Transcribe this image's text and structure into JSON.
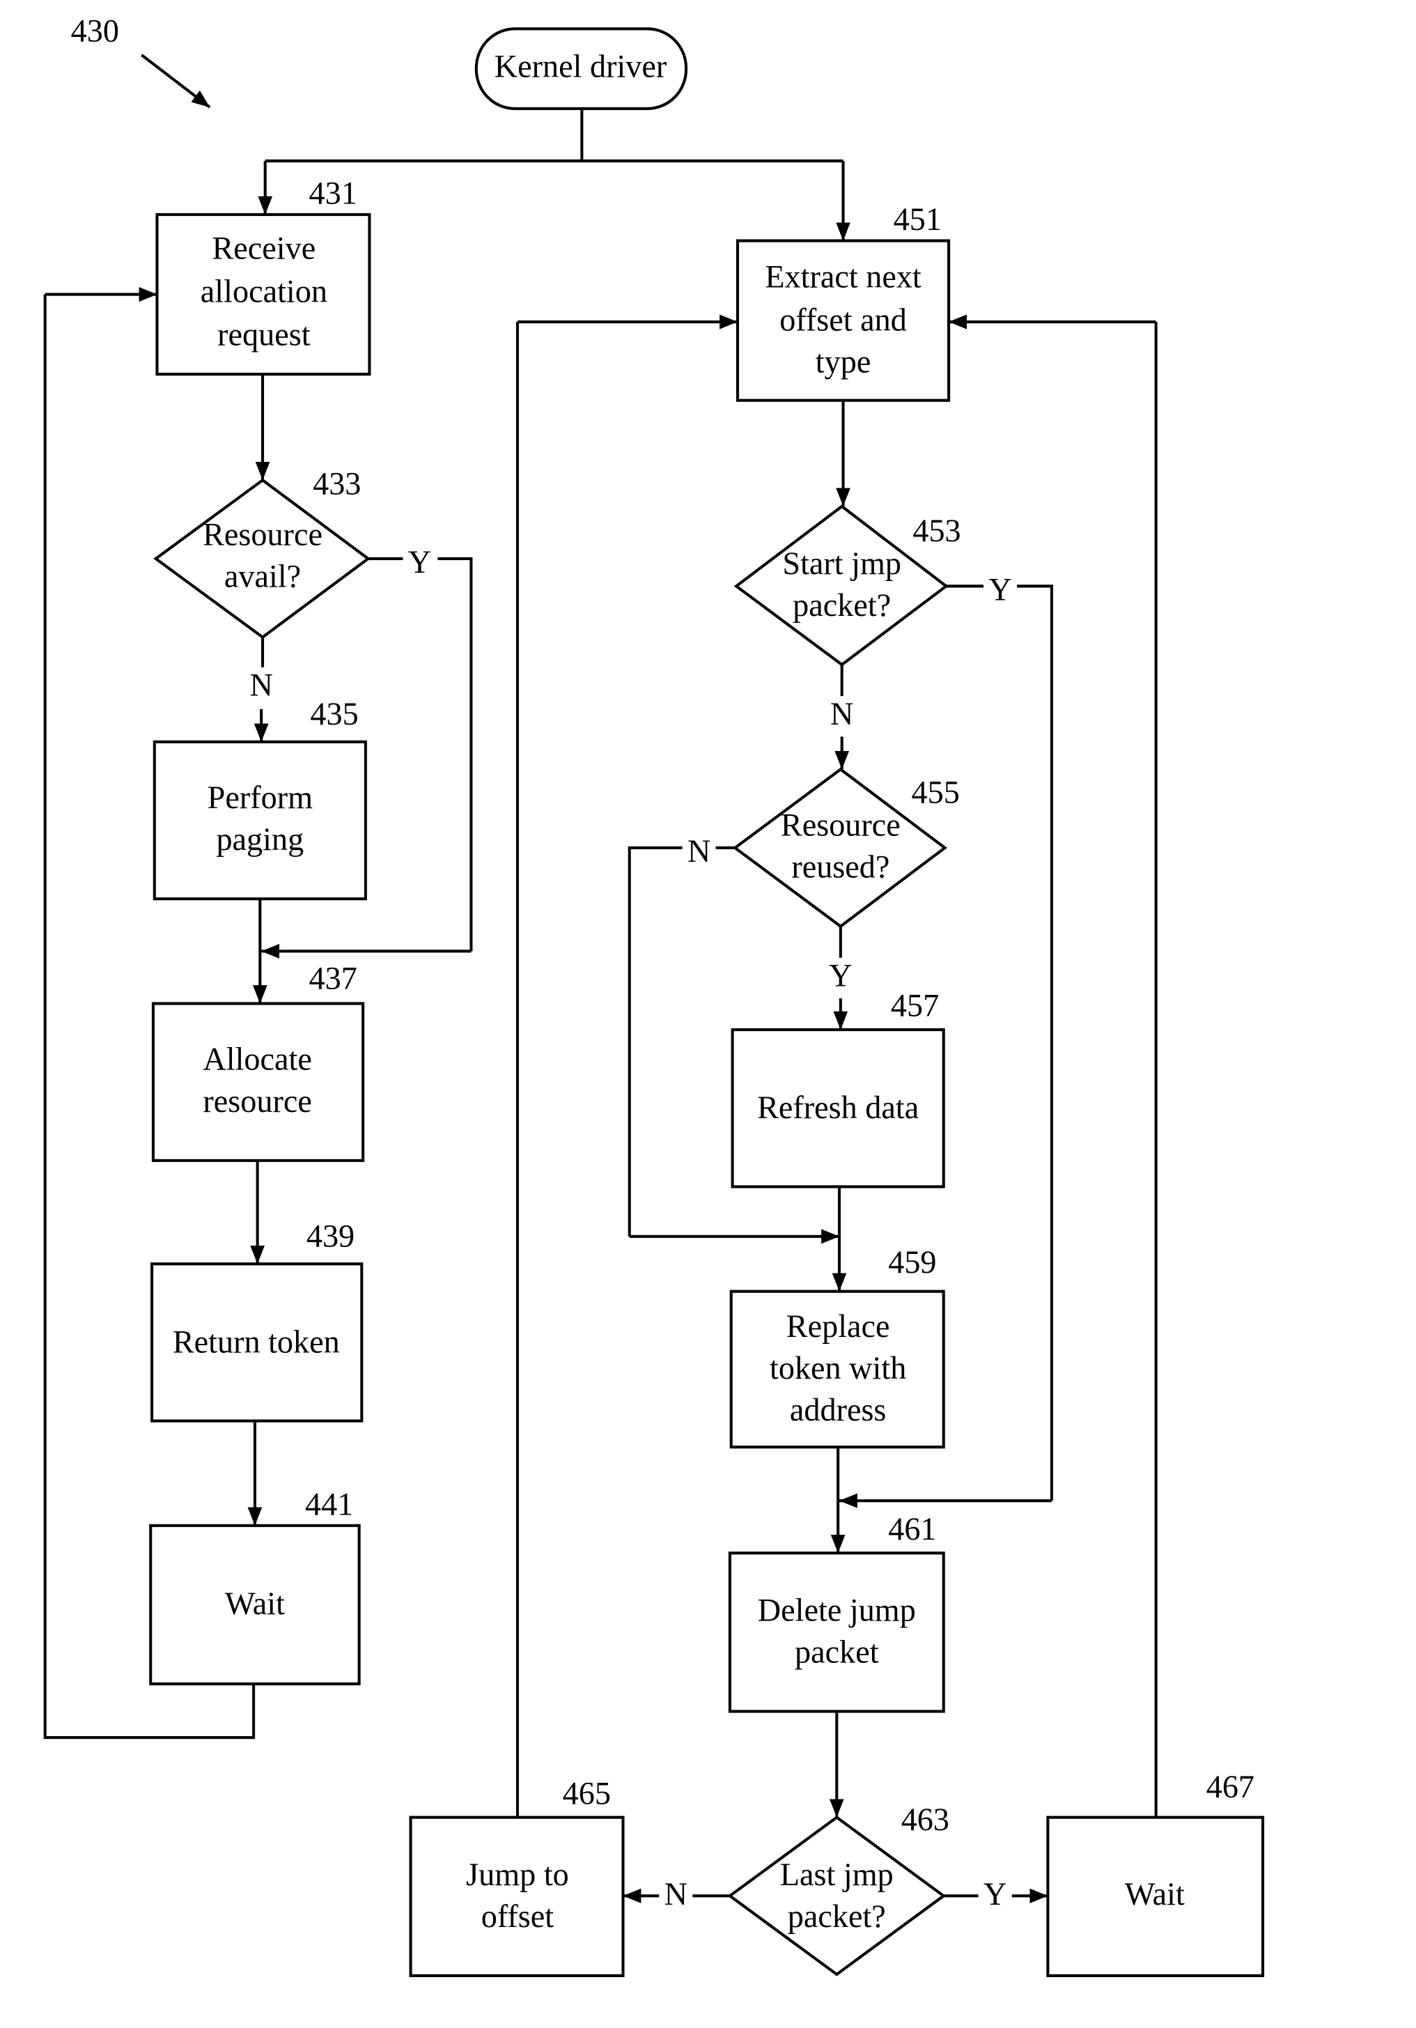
{
  "figure": {
    "ref": "430",
    "start": "Kernel driver"
  },
  "left_flow": {
    "n431": {
      "ref": "431",
      "lines": [
        "Receive",
        "allocation",
        "request"
      ]
    },
    "n433": {
      "ref": "433",
      "lines": [
        "Resource",
        "avail?"
      ],
      "yes": "Y",
      "no": "N"
    },
    "n435": {
      "ref": "435",
      "lines": [
        "Perform",
        "paging"
      ]
    },
    "n437": {
      "ref": "437",
      "lines": [
        "Allocate",
        "resource"
      ]
    },
    "n439": {
      "ref": "439",
      "lines": [
        "Return token"
      ]
    },
    "n441": {
      "ref": "441",
      "lines": [
        "Wait"
      ]
    }
  },
  "right_flow": {
    "n451": {
      "ref": "451",
      "lines": [
        "Extract next",
        "offset and",
        "type"
      ]
    },
    "n453": {
      "ref": "453",
      "lines": [
        "Start jmp",
        "packet?"
      ],
      "yes": "Y",
      "no": "N"
    },
    "n455": {
      "ref": "455",
      "lines": [
        "Resource",
        "reused?"
      ],
      "yes": "Y",
      "no": "N"
    },
    "n457": {
      "ref": "457",
      "lines": [
        "Refresh data"
      ]
    },
    "n459": {
      "ref": "459",
      "lines": [
        "Replace",
        "token with",
        "address"
      ]
    },
    "n461": {
      "ref": "461",
      "lines": [
        "Delete jump",
        "packet"
      ]
    },
    "n463": {
      "ref": "463",
      "lines": [
        "Last jmp",
        "packet?"
      ],
      "yes": "Y",
      "no": "N"
    },
    "n465": {
      "ref": "465",
      "lines": [
        "Jump to",
        "offset"
      ]
    },
    "n467": {
      "ref": "467",
      "lines": [
        "Wait"
      ]
    }
  }
}
